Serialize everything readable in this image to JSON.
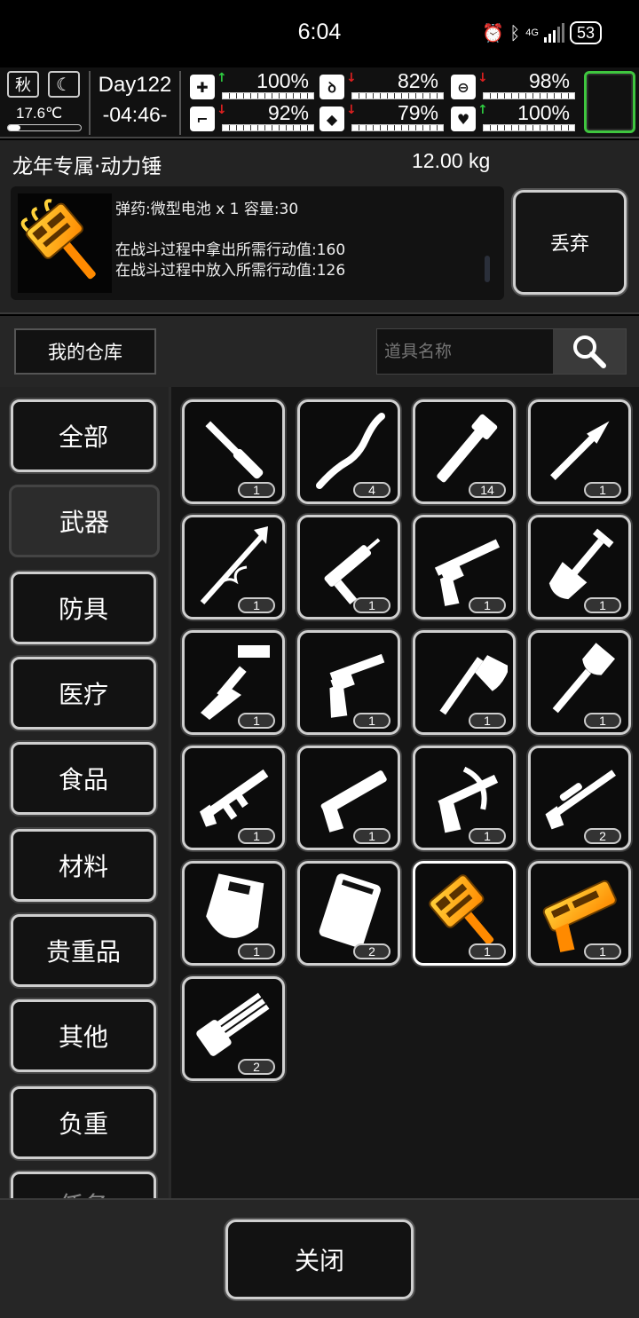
{
  "status_bar": {
    "time": "6:04",
    "battery": "53",
    "network": "4G"
  },
  "hud": {
    "season": "秋",
    "temperature": "17.6℃",
    "day": "Day122",
    "clock": "-04:46-",
    "stats": [
      {
        "icon": "medkit-icon",
        "trend": "up",
        "value": "100%"
      },
      {
        "icon": "stomach-icon",
        "trend": "down",
        "value": "82%"
      },
      {
        "icon": "capsule-icon",
        "trend": "down",
        "value": "98%"
      },
      {
        "icon": "boot-icon",
        "trend": "down",
        "value": "92%"
      },
      {
        "icon": "water-drop-icon",
        "trend": "down",
        "value": "79%"
      },
      {
        "icon": "heart-icon",
        "trend": "up",
        "value": "100%"
      }
    ]
  },
  "item": {
    "name": "龙年专属·动力锤",
    "weight": "12.00 kg",
    "desc_lines": [
      "弹药:微型电池 x 1 容量:30",
      "",
      "在战斗过程中拿出所需行动值:160",
      "在战斗过程中放入所需行动值:126"
    ],
    "discard_label": "丢弃"
  },
  "warehouse": {
    "button_label": "我的仓库",
    "search_placeholder": "道具名称"
  },
  "categories": [
    "全部",
    "武器",
    "防具",
    "医疗",
    "食品",
    "材料",
    "贵重品",
    "其他",
    "负重",
    "任务"
  ],
  "active_category": 1,
  "items": [
    {
      "icon": "screwdriver-icon",
      "count": "1"
    },
    {
      "icon": "twisted-staff-icon",
      "count": "4"
    },
    {
      "icon": "pipe-wrench-club-icon",
      "count": "14"
    },
    {
      "icon": "spear-icon",
      "count": "1"
    },
    {
      "icon": "vine-spear-icon",
      "count": "1"
    },
    {
      "icon": "caulk-gun-icon",
      "count": "1"
    },
    {
      "icon": "shotgun-revolver-icon",
      "count": "1"
    },
    {
      "icon": "shovel-icon",
      "count": "1"
    },
    {
      "icon": "cleaver-hammer-icon",
      "count": "1"
    },
    {
      "icon": "revolver-icon",
      "count": "1"
    },
    {
      "icon": "axe-icon",
      "count": "1"
    },
    {
      "icon": "spade-icon",
      "count": "1"
    },
    {
      "icon": "assault-rifle-icon",
      "count": "1"
    },
    {
      "icon": "pump-shotgun-icon",
      "count": "1"
    },
    {
      "icon": "crossbow-icon",
      "count": "1"
    },
    {
      "icon": "sniper-rifle-icon",
      "count": "2"
    },
    {
      "icon": "riot-shield-icon",
      "count": "1"
    },
    {
      "icon": "crate-shield-icon",
      "count": "2"
    },
    {
      "icon": "power-hammer-icon",
      "count": "1"
    },
    {
      "icon": "dragon-blaster-icon",
      "count": "1"
    },
    {
      "icon": "minigun-icon",
      "count": "2"
    }
  ],
  "selected_item": 18,
  "close_label": "关闭"
}
